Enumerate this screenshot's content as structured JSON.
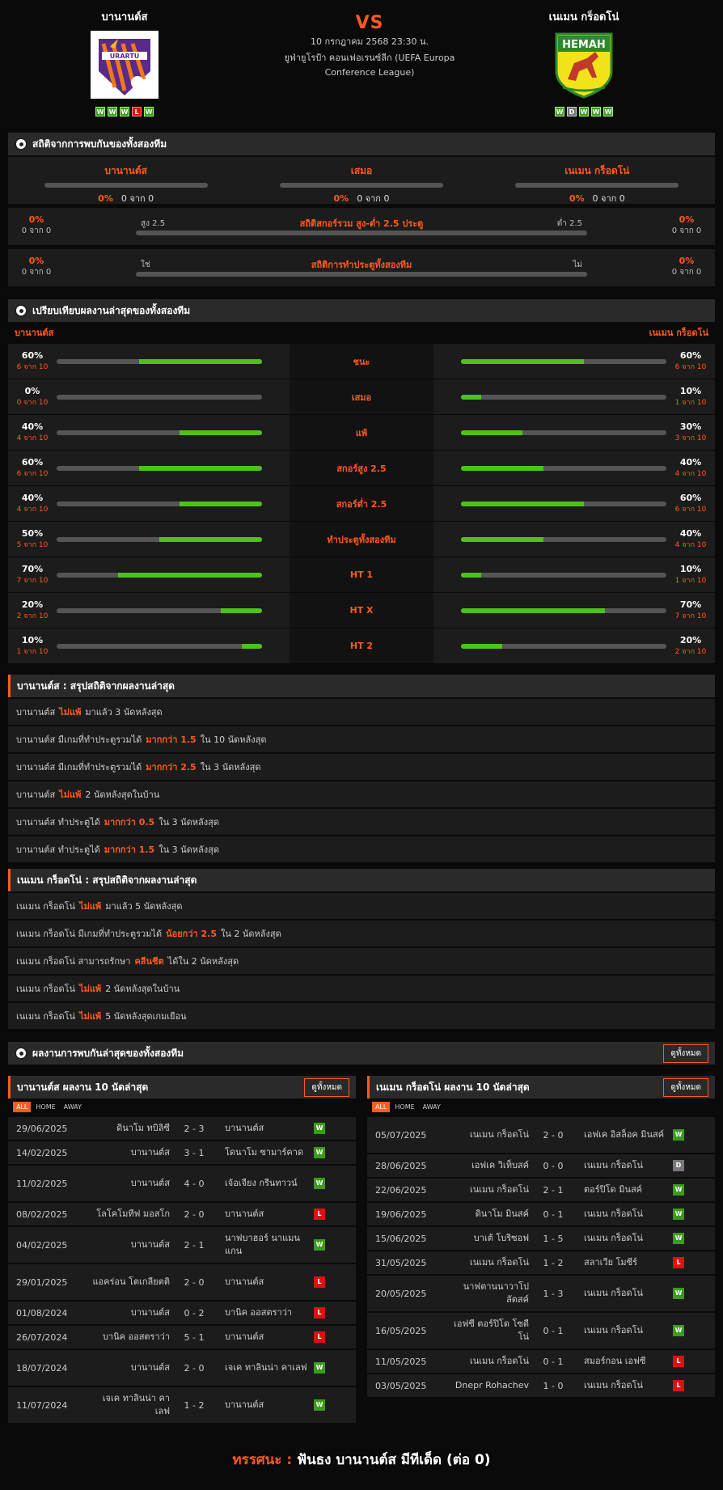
{
  "header": {
    "home": "บานานต์ส",
    "away": "เนเมน กร็อดโน่",
    "vs": "VS",
    "date": "10 กรกฎาคม 2568 23:30 น.",
    "league": "ยูฟ่ายูโรป้า คอนเฟอเรนซ์ลีก (UEFA Europa Conference League)",
    "home_form": [
      "W",
      "W",
      "W",
      "L",
      "W"
    ],
    "away_form": [
      "W",
      "D",
      "W",
      "W",
      "W"
    ]
  },
  "h2h": {
    "title": "สถิติจากการพบกันของทั้งสองทีม",
    "cols": [
      {
        "label": "บานานต์ส",
        "pct": "0%",
        "count": "0 จาก 0"
      },
      {
        "label": "เสมอ",
        "pct": "0%",
        "count": "0 จาก 0"
      },
      {
        "label": "เนเมน กร็อดโน่",
        "pct": "0%",
        "count": "0 จาก 0"
      }
    ],
    "ou": {
      "title": "สถิติสกอร์รวม สูง-ต่ำ 2.5 ประตู",
      "left_label": "สูง 2.5",
      "right_label": "ต่ำ 2.5",
      "l_pct": "0%",
      "l_count": "0 จาก 0",
      "r_pct": "0%",
      "r_count": "0 จาก 0"
    },
    "bt": {
      "title": "สถิติการทำประตูทั้งสองทีม",
      "left_label": "ใช่",
      "right_label": "ไม่",
      "l_pct": "0%",
      "l_count": "0 จาก 0",
      "r_pct": "0%",
      "r_count": "0 จาก 0"
    }
  },
  "compare": {
    "title": "เปรียบเทียบผลงานล่าสุดของทั้งสองทีม",
    "home": "บานานต์ส",
    "away": "เนเมน กร็อดโน่",
    "rows": [
      {
        "label": "ชนะ",
        "hp": "60%",
        "hc": "6 จาก 10",
        "hv": 0.6,
        "ap": "60%",
        "ac": "6 จาก 10",
        "av": 0.6
      },
      {
        "label": "เสมอ",
        "hp": "0%",
        "hc": "0 จาก 10",
        "hv": 0,
        "ap": "10%",
        "ac": "1 จาก 10",
        "av": 0.1
      },
      {
        "label": "แพ้",
        "hp": "40%",
        "hc": "4 จาก 10",
        "hv": 0.4,
        "ap": "30%",
        "ac": "3 จาก 10",
        "av": 0.3
      },
      {
        "label": "สกอร์สูง 2.5",
        "hp": "60%",
        "hc": "6 จาก 10",
        "hv": 0.6,
        "ap": "40%",
        "ac": "4 จาก 10",
        "av": 0.4
      },
      {
        "label": "สกอร์ต่ำ 2.5",
        "hp": "40%",
        "hc": "4 จาก 10",
        "hv": 0.4,
        "ap": "60%",
        "ac": "6 จาก 10",
        "av": 0.6
      },
      {
        "label": "ทำประตูทั้งสองทีม",
        "hp": "50%",
        "hc": "5 จาก 10",
        "hv": 0.5,
        "ap": "40%",
        "ac": "4 จาก 10",
        "av": 0.4
      },
      {
        "label": "HT 1",
        "hp": "70%",
        "hc": "7 จาก 10",
        "hv": 0.7,
        "ap": "10%",
        "ac": "1 จาก 10",
        "av": 0.1
      },
      {
        "label": "HT X",
        "hp": "20%",
        "hc": "2 จาก 10",
        "hv": 0.2,
        "ap": "70%",
        "ac": "7 จาก 10",
        "av": 0.7
      },
      {
        "label": "HT 2",
        "hp": "10%",
        "hc": "1 จาก 10",
        "hv": 0.1,
        "ap": "20%",
        "ac": "2 จาก 10",
        "av": 0.2
      }
    ]
  },
  "home_summary": {
    "title": "บานานต์ส : สรุปสถิติจากผลงานล่าสุด",
    "items": [
      [
        "บานานต์ส",
        "ไม่แพ้",
        "มาแล้ว 3 นัดหลังสุด"
      ],
      [
        "บานานต์ส มีเกมที่ทำประตูรวมได้",
        "มากกว่า 1.5",
        "ใน 10 นัดหลังสุด"
      ],
      [
        "บานานต์ส มีเกมที่ทำประตูรวมได้",
        "มากกว่า 2.5",
        "ใน 3 นัดหลังสุด"
      ],
      [
        "บานานต์ส",
        "ไม่แพ้",
        "2 นัดหลังสุดในบ้าน"
      ],
      [
        "บานานต์ส ทำประตูได้",
        "มากกว่า 0.5",
        "ใน 3 นัดหลังสุด"
      ],
      [
        "บานานต์ส ทำประตูได้",
        "มากกว่า 1.5",
        "ใน 3 นัดหลังสุด"
      ]
    ]
  },
  "away_summary": {
    "title": "เนเมน กร็อดโน่ : สรุปสถิติจากผลงานล่าสุด",
    "items": [
      [
        "เนเมน กร็อดโน่",
        "ไม่แพ้",
        "มาแล้ว 5 นัดหลังสุด"
      ],
      [
        "เนเมน กร็อดโน่ มีเกมที่ทำประตูรวมได้",
        "น้อยกว่า 2.5",
        "ใน 2 นัดหลังสุด"
      ],
      [
        "เนเมน กร็อดโน่ สามารถรักษา",
        "คลีนชีต",
        "ได้ใน 2 นัดหลังสุด"
      ],
      [
        "เนเมน กร็อดโน่",
        "ไม่แพ้",
        "2 นัดหลังสุดในบ้าน"
      ],
      [
        "เนเมน กร็อดโน่",
        "ไม่แพ้",
        "5 นัดหลังสุดเกมเยือน"
      ]
    ]
  },
  "recent": {
    "title": "ผลงานการพบกันล่าสุดของทั้งสองทีม",
    "see_all": "ดูทั้งหมด",
    "tabs": [
      "ALL",
      "HOME",
      "AWAY"
    ],
    "home": {
      "title": "บานานต์ส ผลงาน 10 นัดล่าสุด",
      "matches": [
        [
          "29/06/2025",
          "ดินาโม ทบิลิซี",
          "2 - 3",
          "บานานต์ส",
          "W"
        ],
        [
          "14/02/2025",
          "บานานต์ส",
          "3 - 1",
          "โดนาโม ซามาร์คาด",
          "W"
        ],
        [
          "11/02/2025",
          "บานานต์ส",
          "4 - 0",
          "เจ้อเจียง กรีนทาวน์",
          "W"
        ],
        [
          "08/02/2025",
          "โลโคโมทีฟ มอสโก",
          "2 - 0",
          "บานานต์ส",
          "L"
        ],
        [
          "04/02/2025",
          "บานานต์ส",
          "2 - 1",
          "นาฟบาฮอร์ นาแมนแกน",
          "W"
        ],
        [
          "29/01/2025",
          "แอคร่อน โตเกลียตติ",
          "2 - 0",
          "บานานต์ส",
          "L"
        ],
        [
          "01/08/2024",
          "บานานต์ส",
          "0 - 2",
          "บานิค ออสตราว่า",
          "L"
        ],
        [
          "26/07/2024",
          "บานิค ออสตราว่า",
          "5 - 1",
          "บานานต์ส",
          "L"
        ],
        [
          "18/07/2024",
          "บานานต์ส",
          "2 - 0",
          "เจเค ทาลินน่า คาเลฟ",
          "W"
        ],
        [
          "11/07/2024",
          "เจเค ทาลินน่า คาเลฟ",
          "1 - 2",
          "บานานต์ส",
          "W"
        ]
      ]
    },
    "away": {
      "title": "เนเมน กร็อดโน่ ผลงาน 10 นัดล่าสุด",
      "matches": [
        [
          "05/07/2025",
          "เนเมน กร็อดโน่",
          "2 - 0",
          "เอฟเค อิสล็อค มินสค์",
          "W"
        ],
        [
          "28/06/2025",
          "เอฟเค วิเท็บสค์",
          "0 - 0",
          "เนเมน กร็อดโน่",
          "D"
        ],
        [
          "22/06/2025",
          "เนเมน กร็อดโน่",
          "2 - 1",
          "ตอร์ปิโด มินสค์",
          "W"
        ],
        [
          "19/06/2025",
          "ดินาโม มินสค์",
          "0 - 1",
          "เนเมน กร็อดโน่",
          "W"
        ],
        [
          "15/06/2025",
          "บาเต้ โบริซอฟ",
          "1 - 5",
          "เนเมน กร็อดโน่",
          "W"
        ],
        [
          "31/05/2025",
          "เนเมน กร็อดโน่",
          "1 - 2",
          "สลาเวีย โมซีร์",
          "L"
        ],
        [
          "20/05/2025",
          "นาฟตานนาวาโปลัตสค์",
          "1 - 3",
          "เนเมน กร็อดโน่",
          "W"
        ],
        [
          "16/05/2025",
          "เอฟซี ตอร์ปิโด โซดีโน่",
          "0 - 1",
          "เนเมน กร็อดโน่",
          "W"
        ],
        [
          "11/05/2025",
          "เนเมน กร็อดโน่",
          "0 - 1",
          "สมอร์กอน เอฟซี",
          "L"
        ],
        [
          "03/05/2025",
          "Dnepr Rohachev",
          "1 - 0",
          "เนเมน กร็อดโน่",
          "L"
        ]
      ]
    }
  },
  "footer": {
    "label": "ทรรศนะ :",
    "text": "ฟันธง บานานต์ส มีทีเด็ด (ต่อ 0)"
  }
}
